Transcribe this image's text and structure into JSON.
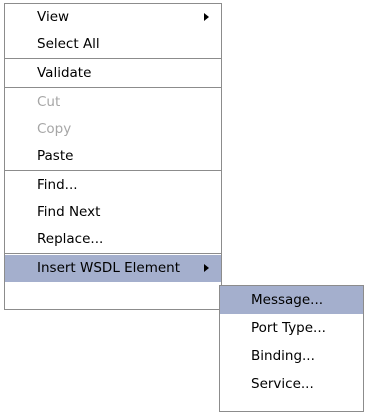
{
  "context_menu": {
    "items": [
      {
        "label": "View",
        "has_submenu": true
      },
      {
        "label": "Select All"
      },
      {
        "label": "Validate"
      },
      {
        "label": "Cut",
        "disabled": true
      },
      {
        "label": "Copy",
        "disabled": true
      },
      {
        "label": "Paste"
      },
      {
        "label": "Find..."
      },
      {
        "label": "Find Next"
      },
      {
        "label": "Replace..."
      },
      {
        "label": "Insert WSDL Element",
        "has_submenu": true,
        "highlighted": true
      }
    ]
  },
  "submenu": {
    "parent": "Insert WSDL Element",
    "items": [
      {
        "label": "Message...",
        "highlighted": true
      },
      {
        "label": "Port Type..."
      },
      {
        "label": "Binding..."
      },
      {
        "label": "Service..."
      }
    ]
  },
  "colors": {
    "highlight": "#a4afcd",
    "border": "#8c8c8c",
    "disabled_text": "#a6a6a6"
  }
}
